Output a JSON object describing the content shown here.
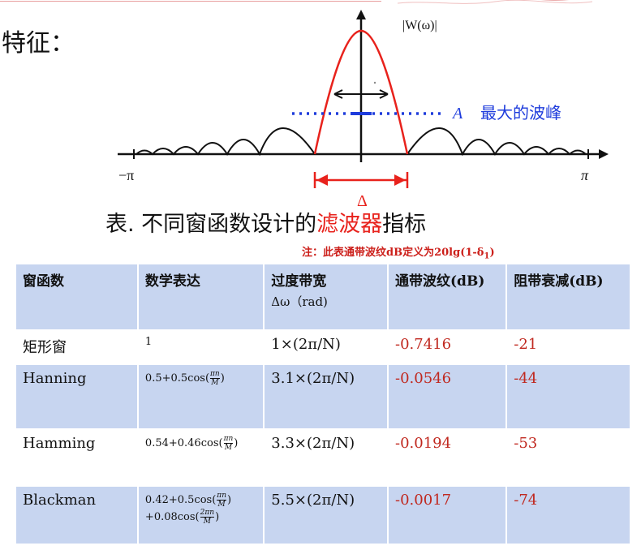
{
  "heading": "特征：",
  "figure": {
    "ylabel": "|W(ω)|",
    "x_left": "−π",
    "x_right": "π",
    "delta": "Δ",
    "peak_symbol": "A",
    "peak_label": "最大的波峰",
    "colors": {
      "mainlobe": "#e8221c",
      "sidelobe": "#111111",
      "peak": "#1e3cdc"
    }
  },
  "caption": {
    "prefix": "表. 不同窗函数设计的",
    "highlight": "滤波器",
    "suffix": "指标"
  },
  "note": {
    "text": "注：此表通带波纹dB定义为20lg(1-δ",
    "sub": "1",
    "end": ")"
  },
  "table": {
    "headers": [
      "窗函数",
      "数学表达",
      "过度带宽",
      "通带波纹(dB)",
      "阻带衰减(dB)"
    ],
    "header_sub": "Δω（rad)",
    "rows": [
      {
        "name": "矩形窗",
        "expr": "1",
        "width": "1×(2π/N)",
        "ripple": "-0.7416",
        "atten": "-21"
      },
      {
        "name": "Hanning",
        "expr": "0.5+0.5cos(",
        "expr_num": "πn",
        "expr_den": "M",
        "expr_end": ")",
        "width": "3.1×(2π/N)",
        "ripple": "-0.0546",
        "atten": "-44"
      },
      {
        "name": "Hamming",
        "expr": "0.54+0.46cos(",
        "expr_num": "πn",
        "expr_den": "M",
        "expr_end": ")",
        "width": "3.3×(2π/N)",
        "ripple": "-0.0194",
        "atten": "-53"
      },
      {
        "name": "Blackman",
        "expr": "0.42+0.5cos(",
        "expr_num": "πn",
        "expr_den": "M",
        "expr_end": ")",
        "expr2": "+0.08cos(",
        "expr2_num": "2πn",
        "expr2_den": "M",
        "expr2_end": ")",
        "width": "5.5×(2π/N)",
        "ripple": "-0.0017",
        "atten": "-74"
      }
    ]
  }
}
